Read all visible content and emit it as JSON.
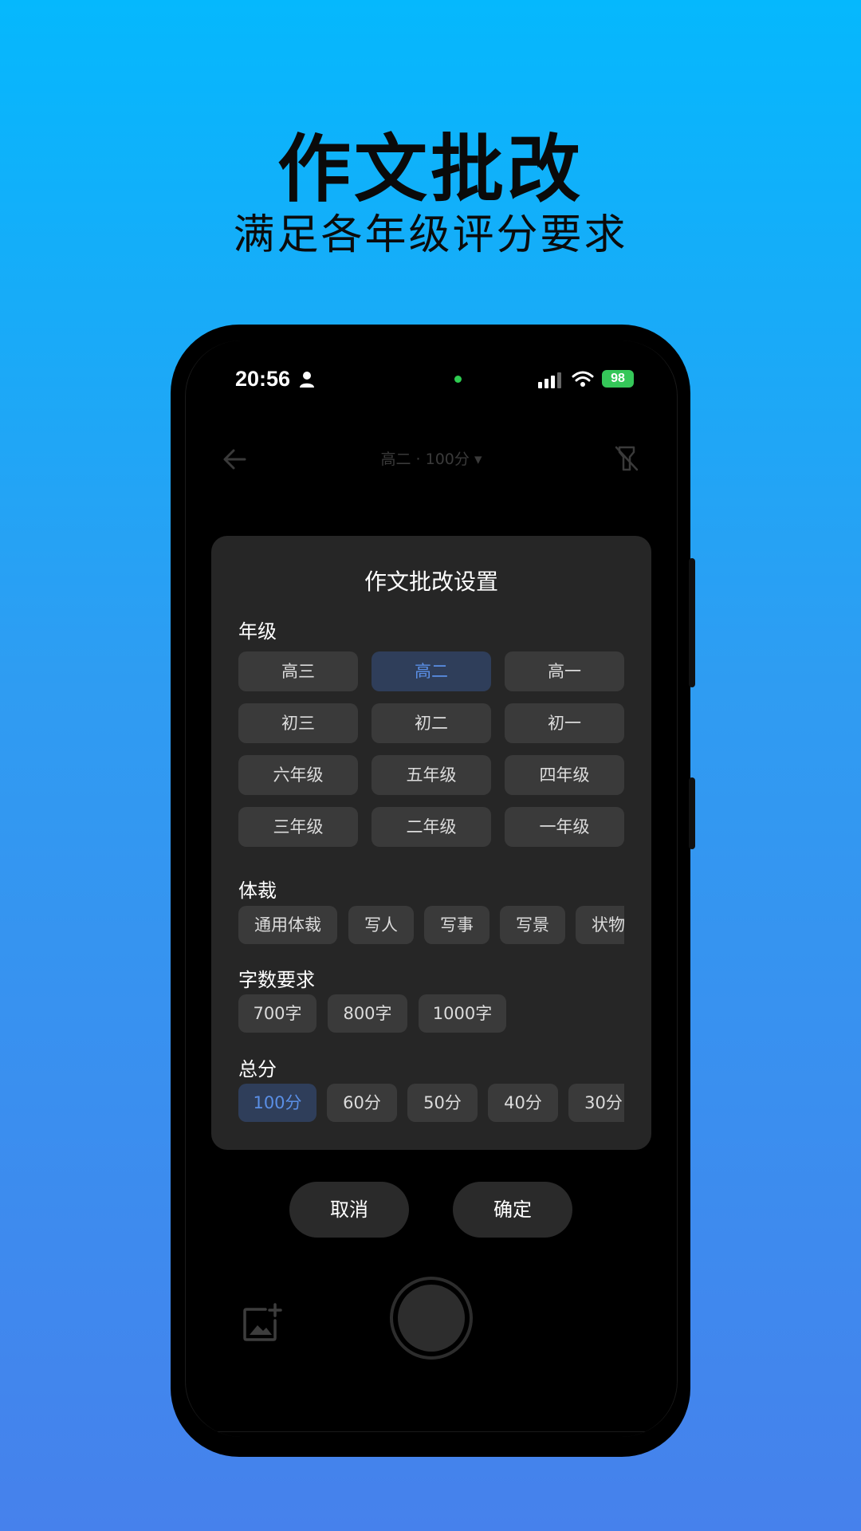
{
  "promo": {
    "title": "作文批改",
    "subtitle": "满足各年级评分要求"
  },
  "status_bar": {
    "time": "20:56",
    "battery": "98"
  },
  "top_bar": {
    "title": "高二 · 100分 ▾"
  },
  "dialog": {
    "title": "作文批改设置",
    "grade_label": "年级",
    "grades": [
      "高三",
      "高二",
      "高一",
      "初三",
      "初二",
      "初一",
      "六年级",
      "五年级",
      "四年级",
      "三年级",
      "二年级",
      "一年级"
    ],
    "selected_grade": "高二",
    "genre_label": "体裁",
    "genres": [
      "通用体裁",
      "写人",
      "写事",
      "写景",
      "状物"
    ],
    "word_label": "字数要求",
    "word_counts": [
      "700字",
      "800字",
      "1000字"
    ],
    "score_label": "总分",
    "scores": [
      "100分",
      "60分",
      "50分",
      "40分",
      "30分"
    ],
    "selected_score": "100分"
  },
  "actions": {
    "cancel": "取消",
    "confirm": "确定"
  },
  "colors": {
    "background_top": "#05b8fd",
    "background_bottom": "#4681ec",
    "selected_text": "#5a8fe6",
    "selected_chip": "#2f3e5a",
    "battery": "#35c759"
  }
}
